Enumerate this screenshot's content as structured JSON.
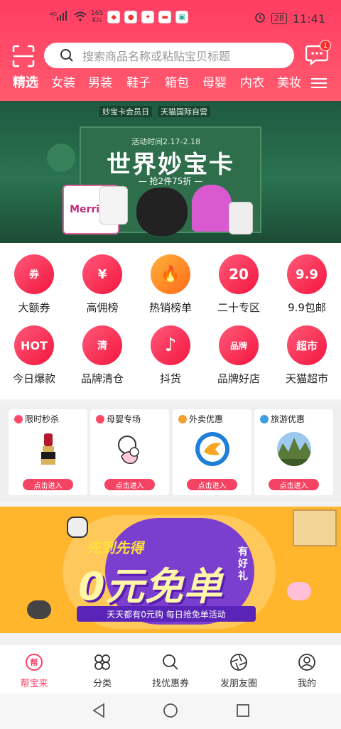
{
  "status": {
    "net_speed": "165\nK/s",
    "battery": "28",
    "time": "11:41"
  },
  "header": {
    "search_placeholder": "搜索商品名称或粘贴宝贝标题",
    "msg_badge": "1",
    "tabs": [
      "精选",
      "女装",
      "男装",
      "鞋子",
      "箱包",
      "母婴",
      "内衣",
      "美妆"
    ]
  },
  "banner": {
    "top_left": "妙宝卡会员日",
    "top_right": "天猫国际自营",
    "date": "活动时间2.17-2.18",
    "title": "世界妙宝卡",
    "subtitle": "— 抢2件75折 —",
    "product_text": "Merries"
  },
  "grid": [
    {
      "label": "大额券",
      "icon": "券"
    },
    {
      "label": "高佣榜",
      "icon": "¥"
    },
    {
      "label": "热销榜单",
      "icon": "🔥"
    },
    {
      "label": "二十专区",
      "icon": "20"
    },
    {
      "label": "9.9包邮",
      "icon": "9.9"
    },
    {
      "label": "今日爆款",
      "icon": "HOT"
    },
    {
      "label": "品牌清仓",
      "icon": "清"
    },
    {
      "label": "抖货",
      "icon": "♪"
    },
    {
      "label": "品牌好店",
      "icon": "品牌"
    },
    {
      "label": "天猫超市",
      "icon": "超市"
    }
  ],
  "promos": [
    {
      "title": "限时秒杀",
      "button": "点击进入"
    },
    {
      "title": "母婴专场",
      "button": "点击进入"
    },
    {
      "title": "外卖优惠",
      "button": "点击进入"
    },
    {
      "title": "旅游优惠",
      "button": "点击进入"
    }
  ],
  "free": {
    "kicker": "先到先得",
    "main": "0元免单",
    "side": "有好礼",
    "bar": "天天都有0元购  每日抢免单活动"
  },
  "bottom_nav": [
    "帮宝来",
    "分类",
    "找优惠券",
    "发朋友圈",
    "我的"
  ]
}
